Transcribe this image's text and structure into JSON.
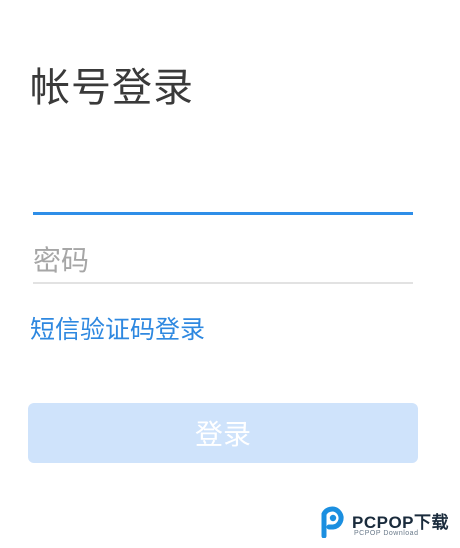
{
  "login": {
    "title": "帐号登录",
    "account_value": "",
    "password_placeholder": "密码",
    "sms_link": "短信验证码登录",
    "submit_label": "登录"
  },
  "watermark": {
    "brand": "PCPOP下载",
    "subtitle": "PCPOP Download"
  },
  "colors": {
    "accent": "#2e8ee8",
    "link": "#2e88e0",
    "button_disabled_bg": "#cfe3fb",
    "title_text": "#3a3a3a",
    "placeholder": "#a6a6a6"
  }
}
